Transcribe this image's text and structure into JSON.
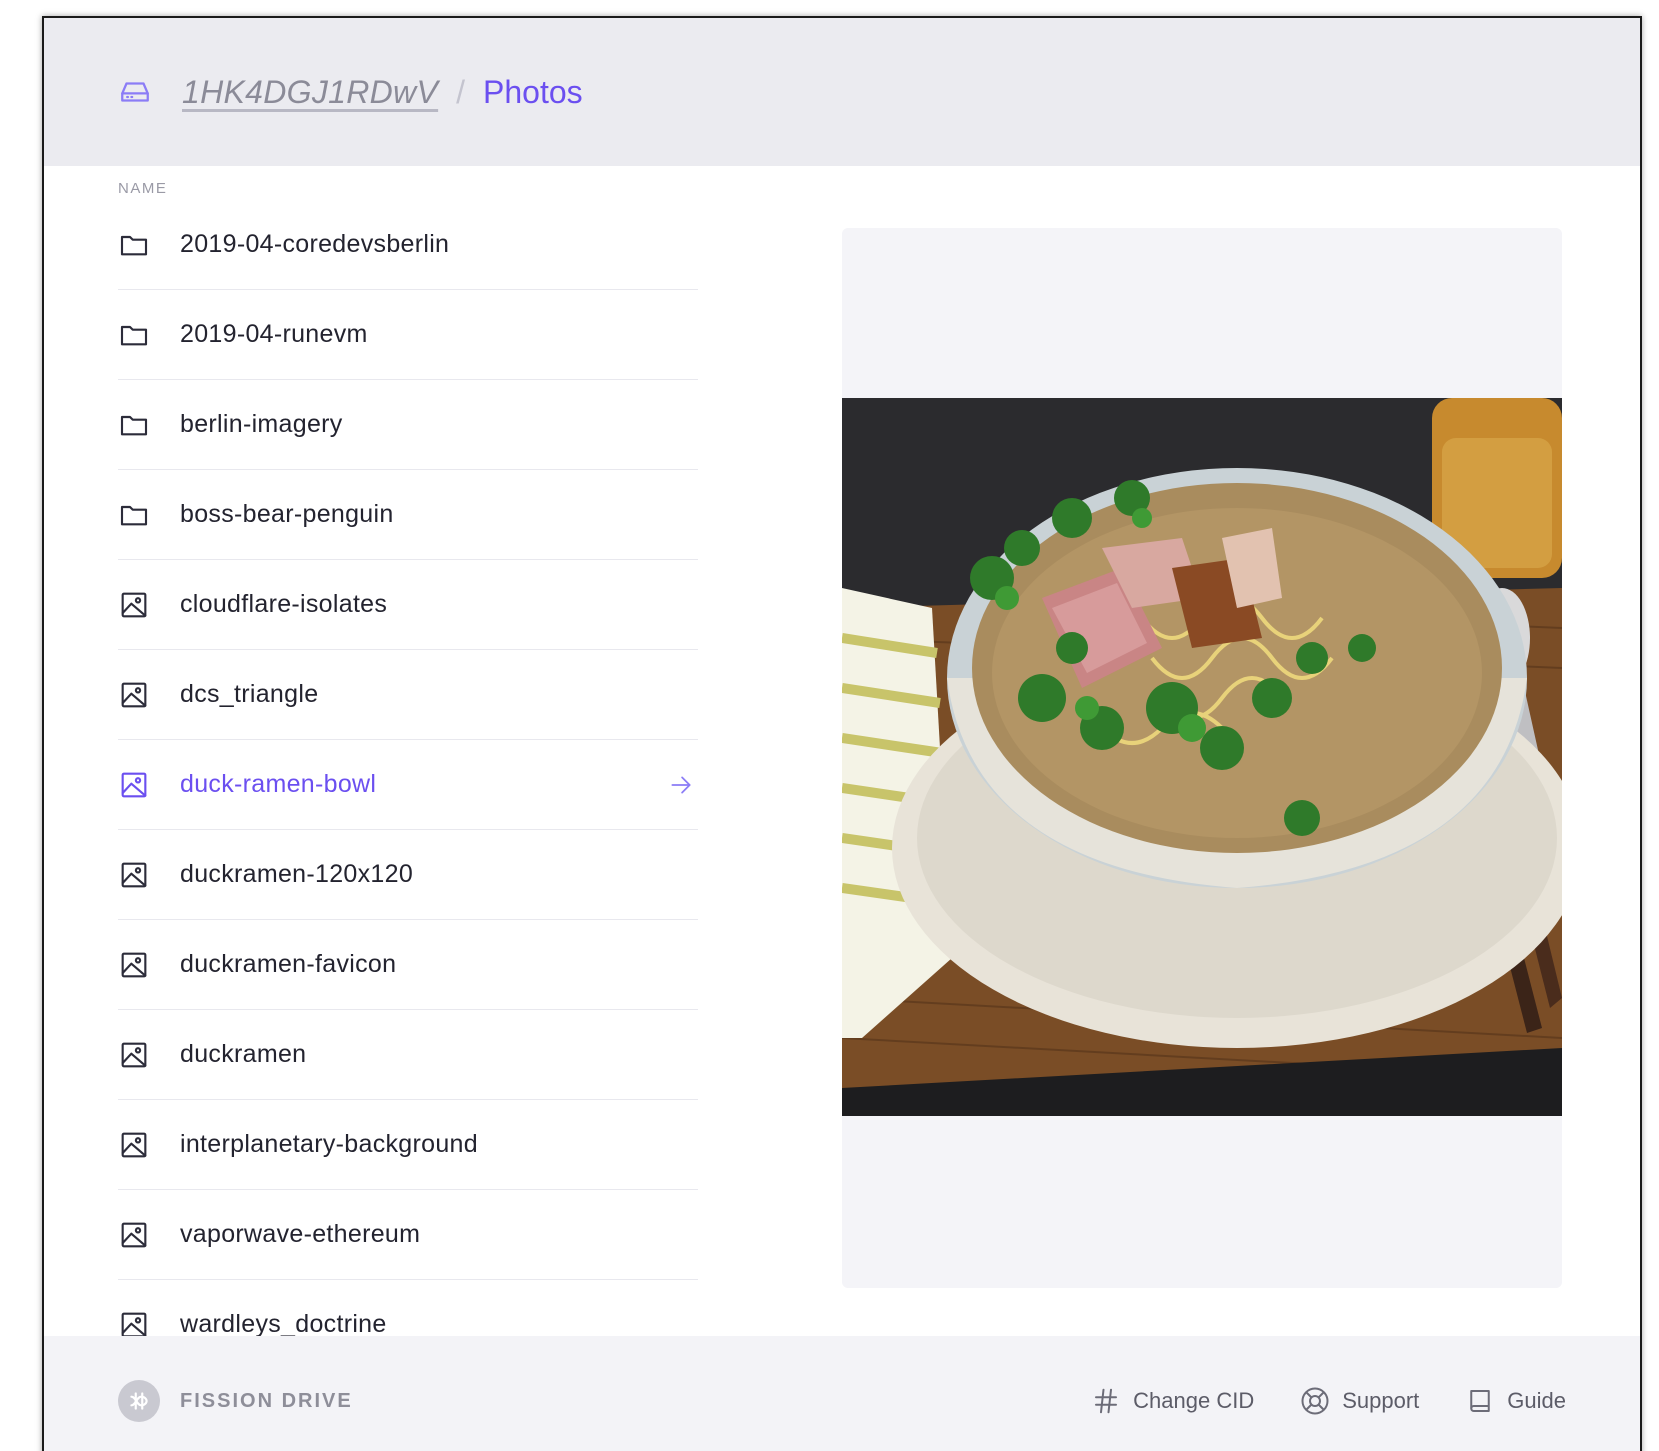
{
  "header": {
    "root_label": "1HK4DGJ1RDwV",
    "separator": "/",
    "current": "Photos"
  },
  "listing": {
    "column_header": "NAME",
    "items": [
      {
        "name": "2019-04-coredevsberlin",
        "type": "folder"
      },
      {
        "name": "2019-04-runevm",
        "type": "folder"
      },
      {
        "name": "berlin-imagery",
        "type": "folder"
      },
      {
        "name": "boss-bear-penguin",
        "type": "folder"
      },
      {
        "name": "cloudflare-isolates",
        "type": "image"
      },
      {
        "name": "dcs_triangle",
        "type": "image"
      },
      {
        "name": "duck-ramen-bowl",
        "type": "image",
        "selected": true
      },
      {
        "name": "duckramen-120x120",
        "type": "image"
      },
      {
        "name": "duckramen-favicon",
        "type": "image"
      },
      {
        "name": "duckramen",
        "type": "image"
      },
      {
        "name": "interplanetary-background",
        "type": "image"
      },
      {
        "name": "vaporwave-ethereum",
        "type": "image"
      },
      {
        "name": "wardleys_doctrine",
        "type": "image"
      }
    ]
  },
  "preview": {
    "image_subject": "duck ramen bowl photo"
  },
  "footer": {
    "brand": "FISSION DRIVE",
    "links": {
      "change_cid": "Change CID",
      "support": "Support",
      "guide": "Guide"
    }
  },
  "colors": {
    "accent": "#6b4ff0",
    "header_bg": "#ebebf0",
    "preview_bg": "#f4f4f8"
  }
}
